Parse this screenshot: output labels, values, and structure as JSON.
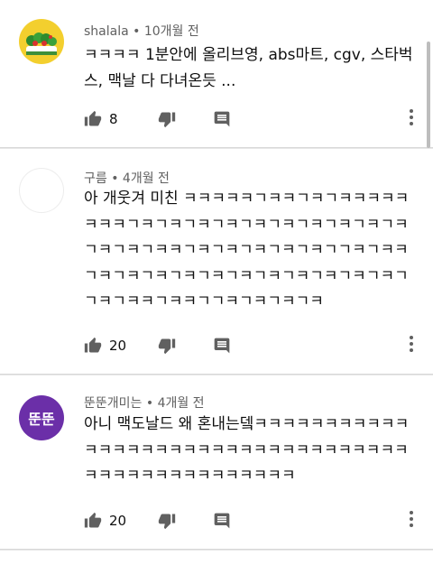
{
  "comments": [
    {
      "author": "shalala",
      "meta": " • 10개월 전",
      "text": "ㅋㅋㅋㅋ 1분안에 올리브영, abs마트,  cgv,  스타벅스, 맥날 다 다녀온듯 ...",
      "likes": "8",
      "avatar": "food-avatar"
    },
    {
      "author": "구름",
      "meta": " • 4개월 전",
      "text": "아 개웃겨 미친 ㅋㅋㅋㅋㅋㄱㅋㅋㄱㅋㄱㅋㅋㅋㅋㅋㅋㅋㅋㄱㅋㄱㅋㄱㅋㄱㅋㄱㅋㄱㅋㄱㅋㄱㅋㄱㅋㄱㅋㄱㅋㄱㅋㄱㅋㅋㄱㅋㄱㅋㄱㅋㄱㅋㄱㅋㄱㄱㅋㄱㅋㅋㄱㅋㄱㅋㄱㅋㄱㅋㄱㅋㄱㅋㄱㅋㄱㅋㄱㅋㄱㅋㄱㅋㄱㄱㅋㄱㅋㅋㄱㅋㅋㄱㄱㅋㄱㅋㄱㅋㄱㅋ",
      "likes": "20",
      "avatar": "blank-avatar"
    },
    {
      "author": "뚠뚠개미는",
      "meta": " • 4개월 전",
      "text": "아니 맥도날드 왜 혼내는뎈ㅋㅋㅋㅋㅋㅋㅋㅋㅋㅋㅋㅋㅋㅋㅋㅋㅋㅋㅋㅋㅋㅋㅋㅋㅋㅋㅋㅋㅋㅋㅋㅋㅋㅋㅋㅋㅋㅋㅋㅋㅋㅋㅋㅋㅋㅋㅋㅋㅋ",
      "likes": "20",
      "avatar_text": "뚠뚠",
      "avatar_color": "#6b2fa8"
    }
  ],
  "icons": {
    "like": "thumbs-up-icon",
    "dislike": "thumbs-down-icon",
    "reply": "reply-icon",
    "more": "more-vertical-icon"
  }
}
